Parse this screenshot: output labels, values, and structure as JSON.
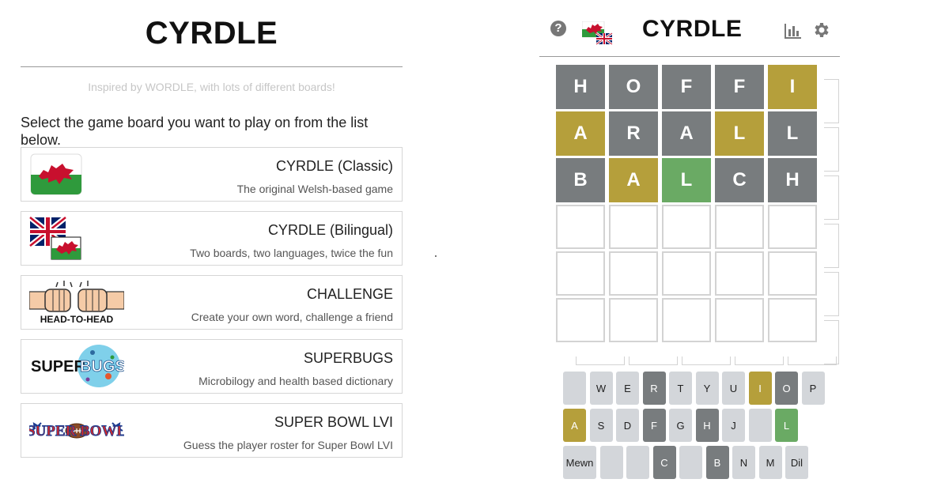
{
  "left": {
    "title": "CYRDLE",
    "tagline": "Inspired by WORDLE, with lots of different boards!",
    "instruction": "Select the game board you want to play on from the list below.",
    "boards": [
      {
        "name": "CYRDLE (Classic)",
        "desc": "The original Welsh-based game"
      },
      {
        "name": "CYRDLE (Bilingual)",
        "desc": "Two boards, two languages, twice the fun"
      },
      {
        "name": "CHALLENGE",
        "desc": "Create your own word, challenge a friend"
      },
      {
        "name": "SUPERBUGS",
        "desc": "Microbilogy and health based dictionary"
      },
      {
        "name": "SUPER BOWL LVI",
        "desc": "Guess the player roster for Super Bowl LVI"
      }
    ],
    "thumb_text": {
      "head": "HEAD-TO-HEAD",
      "superbugs_a": "SUPER",
      "superbugs_b": "BUGS",
      "superbowl": "SUPER BOWL"
    }
  },
  "game": {
    "title": "CYRDLE",
    "help_glyph": "?",
    "rows": [
      {
        "letters": [
          "H",
          "O",
          "F",
          "F",
          "I"
        ],
        "states": [
          "absent",
          "absent",
          "absent",
          "absent",
          "present"
        ]
      },
      {
        "letters": [
          "A",
          "R",
          "A",
          "L",
          "L"
        ],
        "states": [
          "present",
          "absent",
          "absent",
          "present",
          "absent"
        ]
      },
      {
        "letters": [
          "B",
          "A",
          "L",
          "C",
          "H"
        ],
        "states": [
          "absent",
          "present",
          "correct",
          "absent",
          "absent"
        ]
      },
      {
        "letters": [
          "",
          "",
          "",
          "",
          ""
        ],
        "states": [
          "empty",
          "empty",
          "empty",
          "empty",
          "empty"
        ]
      },
      {
        "letters": [
          "",
          "",
          "",
          "",
          ""
        ],
        "states": [
          "empty",
          "empty",
          "empty",
          "empty",
          "empty"
        ]
      },
      {
        "letters": [
          "",
          "",
          "",
          "",
          ""
        ],
        "states": [
          "empty",
          "empty",
          "empty",
          "empty",
          "empty"
        ]
      }
    ],
    "keyboard": [
      [
        {
          "k": "",
          "s": ""
        },
        {
          "k": "W",
          "s": ""
        },
        {
          "k": "E",
          "s": ""
        },
        {
          "k": "R",
          "s": "absent"
        },
        {
          "k": "T",
          "s": ""
        },
        {
          "k": "Y",
          "s": ""
        },
        {
          "k": "U",
          "s": ""
        },
        {
          "k": "I",
          "s": "present"
        },
        {
          "k": "O",
          "s": "absent"
        },
        {
          "k": "P",
          "s": ""
        }
      ],
      [
        {
          "k": "A",
          "s": "present"
        },
        {
          "k": "S",
          "s": ""
        },
        {
          "k": "D",
          "s": ""
        },
        {
          "k": "F",
          "s": "absent"
        },
        {
          "k": "G",
          "s": ""
        },
        {
          "k": "H",
          "s": "absent"
        },
        {
          "k": "J",
          "s": ""
        },
        {
          "k": "",
          "s": ""
        },
        {
          "k": "L",
          "s": "correct"
        }
      ],
      [
        {
          "k": "Mewn",
          "s": "wide"
        },
        {
          "k": "",
          "s": ""
        },
        {
          "k": "",
          "s": ""
        },
        {
          "k": "C",
          "s": "absent"
        },
        {
          "k": "",
          "s": ""
        },
        {
          "k": "B",
          "s": "absent"
        },
        {
          "k": "N",
          "s": ""
        },
        {
          "k": "M",
          "s": ""
        },
        {
          "k": "Dil",
          "s": ""
        }
      ]
    ],
    "colors": {
      "absent": "#787c7e",
      "present": "#b59f3b",
      "correct": "#6aaa64",
      "key": "#d3d6da"
    }
  }
}
